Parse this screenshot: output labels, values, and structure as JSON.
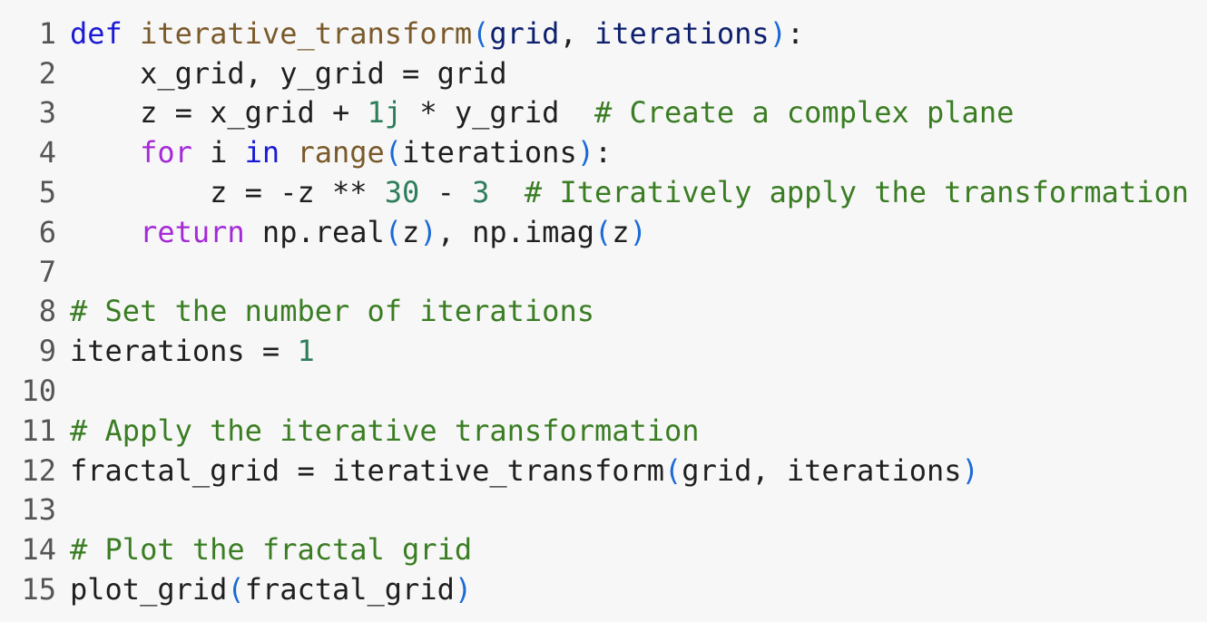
{
  "editor": {
    "lines": [
      {
        "number": "1",
        "tokens": [
          {
            "text": "def",
            "type": "kw"
          },
          {
            "text": " ",
            "type": "plain"
          },
          {
            "text": "iterative_transform",
            "type": "fn"
          },
          {
            "text": "(",
            "type": "paren"
          },
          {
            "text": "grid",
            "type": "param"
          },
          {
            "text": ", ",
            "type": "plain"
          },
          {
            "text": "iterations",
            "type": "param"
          },
          {
            "text": ")",
            "type": "paren"
          },
          {
            "text": ":",
            "type": "plain"
          }
        ]
      },
      {
        "number": "2",
        "tokens": [
          {
            "text": "    x_grid, y_grid = grid",
            "type": "plain"
          }
        ]
      },
      {
        "number": "3",
        "tokens": [
          {
            "text": "    z = x_grid + ",
            "type": "plain"
          },
          {
            "text": "1j",
            "type": "num"
          },
          {
            "text": " * y_grid  ",
            "type": "plain"
          },
          {
            "text": "# Create a complex plane",
            "type": "comment"
          }
        ]
      },
      {
        "number": "4",
        "tokens": [
          {
            "text": "    ",
            "type": "plain"
          },
          {
            "text": "for",
            "type": "ctrl"
          },
          {
            "text": " i ",
            "type": "plain"
          },
          {
            "text": "in",
            "type": "in"
          },
          {
            "text": " ",
            "type": "plain"
          },
          {
            "text": "range",
            "type": "builtin"
          },
          {
            "text": "(",
            "type": "paren"
          },
          {
            "text": "iterations",
            "type": "plain"
          },
          {
            "text": ")",
            "type": "paren"
          },
          {
            "text": ":",
            "type": "plain"
          }
        ]
      },
      {
        "number": "5",
        "tokens": [
          {
            "text": "        z = -z ** ",
            "type": "plain"
          },
          {
            "text": "30",
            "type": "num"
          },
          {
            "text": " - ",
            "type": "plain"
          },
          {
            "text": "3",
            "type": "num"
          },
          {
            "text": "  ",
            "type": "plain"
          },
          {
            "text": "# Iteratively apply the transformation",
            "type": "comment"
          }
        ]
      },
      {
        "number": "6",
        "tokens": [
          {
            "text": "    ",
            "type": "plain"
          },
          {
            "text": "return",
            "type": "ctrl"
          },
          {
            "text": " np.real",
            "type": "plain"
          },
          {
            "text": "(",
            "type": "paren"
          },
          {
            "text": "z",
            "type": "plain"
          },
          {
            "text": ")",
            "type": "paren"
          },
          {
            "text": ", np.imag",
            "type": "plain"
          },
          {
            "text": "(",
            "type": "paren"
          },
          {
            "text": "z",
            "type": "plain"
          },
          {
            "text": ")",
            "type": "paren"
          }
        ]
      },
      {
        "number": "7",
        "tokens": []
      },
      {
        "number": "8",
        "tokens": [
          {
            "text": "# Set the number of iterations",
            "type": "comment"
          }
        ]
      },
      {
        "number": "9",
        "tokens": [
          {
            "text": "iterations = ",
            "type": "plain"
          },
          {
            "text": "1",
            "type": "num"
          }
        ]
      },
      {
        "number": "10",
        "tokens": []
      },
      {
        "number": "11",
        "tokens": [
          {
            "text": "# Apply the iterative transformation",
            "type": "comment"
          }
        ]
      },
      {
        "number": "12",
        "tokens": [
          {
            "text": "fractal_grid = iterative_transform",
            "type": "plain"
          },
          {
            "text": "(",
            "type": "paren"
          },
          {
            "text": "grid, iterations",
            "type": "plain"
          },
          {
            "text": ")",
            "type": "paren"
          }
        ]
      },
      {
        "number": "13",
        "tokens": []
      },
      {
        "number": "14",
        "tokens": [
          {
            "text": "# Plot the fractal grid",
            "type": "comment"
          }
        ]
      },
      {
        "number": "15",
        "tokens": [
          {
            "text": "plot_grid",
            "type": "plain"
          },
          {
            "text": "(",
            "type": "paren"
          },
          {
            "text": "fractal_grid",
            "type": "plain"
          },
          {
            "text": ")",
            "type": "paren"
          }
        ]
      }
    ]
  },
  "colors": {
    "background": "#f7f7f7",
    "line_number": "#555555",
    "keyword": "#1a1ad6",
    "function": "#7a5a2a",
    "comment": "#3a7d23",
    "number": "#2e7d5b",
    "control": "#a42ad6"
  }
}
